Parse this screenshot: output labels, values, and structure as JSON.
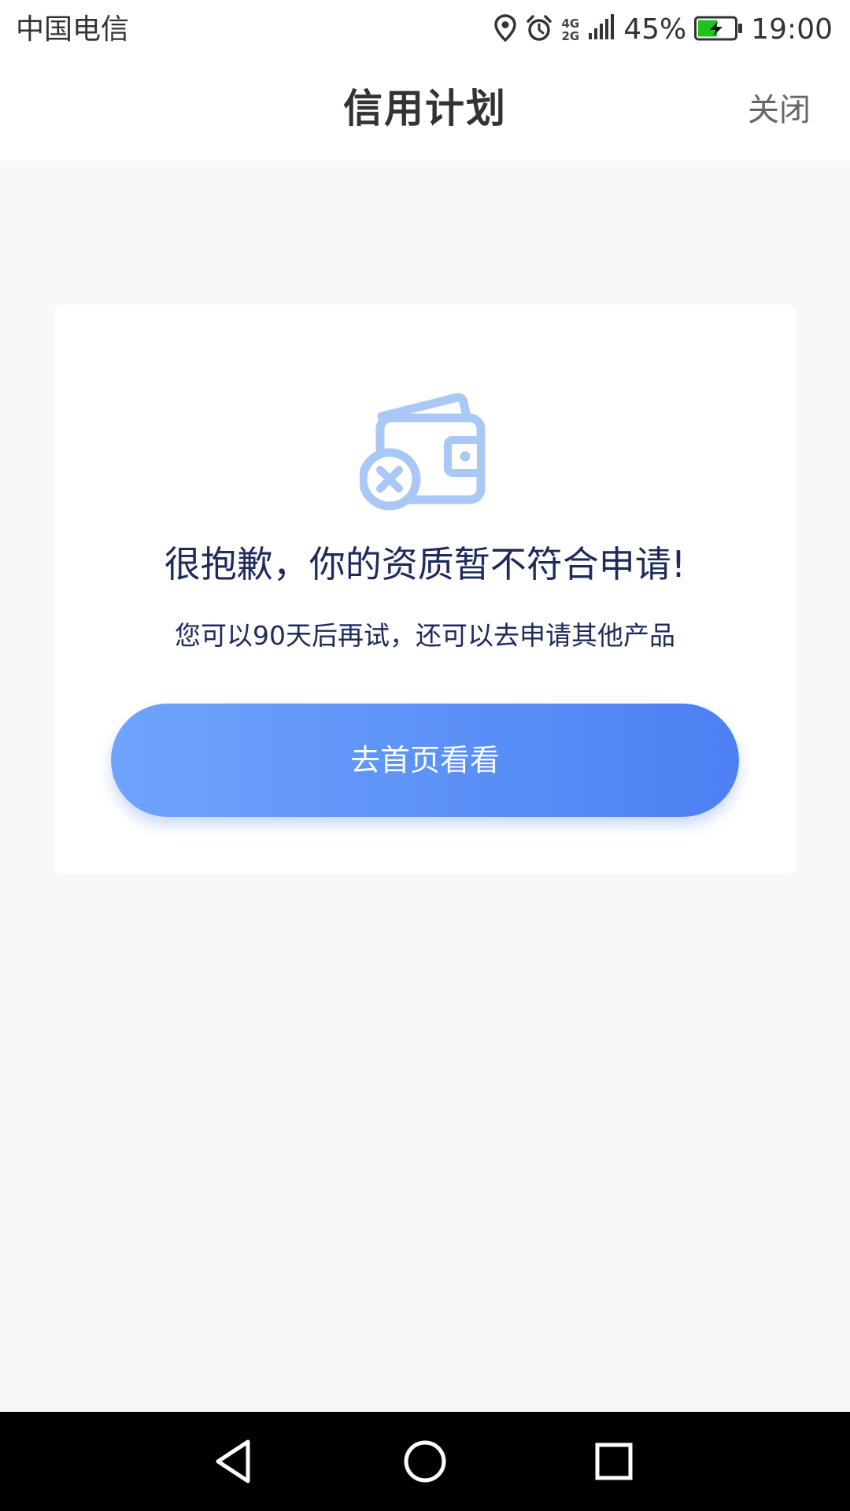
{
  "status_bar": {
    "carrier": "中国电信",
    "network_top": "4G",
    "network_bottom": "2G",
    "battery": "45%",
    "time": "19:00",
    "icons": [
      "location-icon",
      "alarm-icon",
      "signal-icon",
      "battery-charging-icon"
    ]
  },
  "header": {
    "title": "信用计划",
    "close": "关闭"
  },
  "card": {
    "icon": "wallet-error-icon",
    "title": "很抱歉，你的资质暂不符合申请!",
    "subtitle": "您可以90天后再试，还可以去申请其他产品",
    "button": "去首页看看"
  },
  "nav": {
    "icons": [
      "back-icon",
      "home-icon",
      "recent-apps-icon"
    ]
  },
  "colors": {
    "accent_start": "#6fa4fc",
    "accent_end": "#4c80f3",
    "title_text": "#1d2a5c",
    "icon": "#a9c8f5",
    "battery_fill": "#1ec31e"
  }
}
